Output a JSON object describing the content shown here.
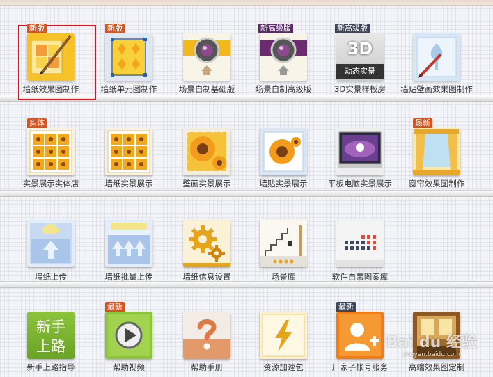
{
  "rows": [
    {
      "items": [
        {
          "label": "墙纸效果图制作",
          "badge": "新版",
          "badge_color": "#d9531e",
          "icon": "wallpaper-effect-icon"
        },
        {
          "label": "墙纸单元图制作",
          "badge": "新版",
          "badge_color": "#d9531e",
          "icon": "wallpaper-unit-icon"
        },
        {
          "label": "场景自制基础版",
          "badge": "",
          "icon": "camera-basic-icon"
        },
        {
          "label": "场景自制高级版",
          "badge": "新高级版",
          "badge_color": "#5b2b69",
          "icon": "camera-advanced-icon"
        },
        {
          "label": "3D实景样板房",
          "badge": "新高级版",
          "badge_color": "#5b2b69",
          "icon": "3d-room-icon",
          "icon_text_main": "3D",
          "icon_text_sub": "动态实景"
        },
        {
          "label": "墙贴壁画效果图制作",
          "badge": "",
          "icon": "wall-sticker-effect-icon"
        }
      ]
    },
    {
      "items": [
        {
          "label": "实景展示实体店",
          "badge": "实体",
          "badge_color": "#d9531e",
          "icon": "store-display-icon"
        },
        {
          "label": "墙纸实景展示",
          "badge": "",
          "icon": "wallpaper-display-icon"
        },
        {
          "label": "壁画实景展示",
          "badge": "",
          "icon": "mural-display-icon"
        },
        {
          "label": "墙贴实景展示",
          "badge": "",
          "icon": "sticker-display-icon"
        },
        {
          "label": "平板电脑实景展示",
          "badge": "",
          "icon": "tablet-display-icon"
        },
        {
          "label": "窗帘效果图制作",
          "badge": "最新",
          "badge_color": "#d9531e",
          "icon": "curtain-icon"
        }
      ]
    },
    {
      "items": [
        {
          "label": "墙纸上传",
          "badge": "",
          "icon": "upload-icon"
        },
        {
          "label": "墙纸批量上传",
          "badge": "",
          "icon": "batch-upload-icon"
        },
        {
          "label": "墙纸信息设置",
          "badge": "",
          "icon": "settings-gear-icon"
        },
        {
          "label": "场景库",
          "badge": "",
          "icon": "scene-library-icon"
        },
        {
          "label": "软件自带图案库",
          "badge": "",
          "icon": "pattern-library-icon"
        }
      ]
    },
    {
      "items": [
        {
          "label": "新手上路指导",
          "badge": "",
          "icon": "beginner-guide-icon",
          "icon_text_main": "新手",
          "icon_text_sub": "上路"
        },
        {
          "label": "帮助视频",
          "badge": "最新",
          "badge_color": "#d9531e",
          "icon": "play-video-icon"
        },
        {
          "label": "帮助手册",
          "badge": "",
          "icon": "question-manual-icon"
        },
        {
          "label": "资源加速包",
          "badge": "",
          "icon": "lightning-icon"
        },
        {
          "label": "厂家子帐号服务",
          "badge": "最新",
          "badge_color": "#3c4558",
          "icon": "add-user-icon"
        },
        {
          "label": "高端效果图定制",
          "badge": "",
          "icon": "premium-effect-icon"
        }
      ]
    }
  ],
  "watermark": {
    "main": "Bai du 经验",
    "sub": "jingyan.baidu.com"
  }
}
